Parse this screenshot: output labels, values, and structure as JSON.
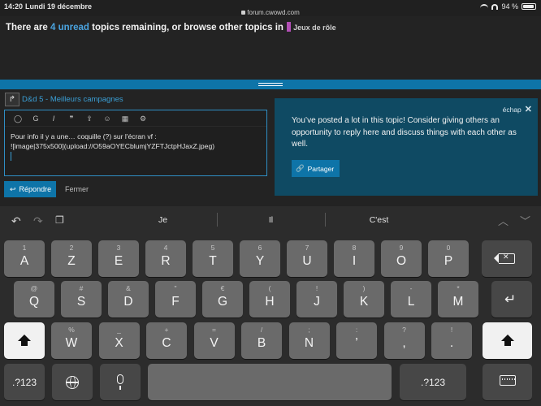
{
  "status": {
    "time": "14:20",
    "date": "Lundi 19 décembre",
    "url": "forum.cwowd.com",
    "battery": "94 %"
  },
  "topic_footer": {
    "prefix": "There are",
    "unread_link": "4 unread",
    "suffix": "topics remaining, or browse other topics in",
    "category": "Jeux de rôle",
    "category_color": "#b24fb5"
  },
  "composer": {
    "topic_title": "D&d 5 - Meilleurs campagnes",
    "toolbar_labels": {
      "heading": "G",
      "italic": "I",
      "quote": "❞"
    },
    "body_lines": [
      "Pour info il y a une… coquille (?) sur l'écran vf :",
      "![image|375x500](upload://O59aOYECblumjYZFTJctpHJaxZ.jpeg)"
    ],
    "reply_label": "Répondre",
    "close_label": "Fermer",
    "accent": "#0e74a8"
  },
  "suggestion": {
    "esc_label": "échap",
    "message": "You’ve posted a lot in this topic! Consider giving others an opportunity to reply here and discuss things with each other as well.",
    "share_label": "Partager"
  },
  "keyboard": {
    "predictions": [
      "Je",
      "Il",
      "C'est"
    ],
    "row1": [
      {
        "sec": "1",
        "pri": "A"
      },
      {
        "sec": "2",
        "pri": "Z"
      },
      {
        "sec": "3",
        "pri": "E"
      },
      {
        "sec": "4",
        "pri": "R"
      },
      {
        "sec": "5",
        "pri": "T"
      },
      {
        "sec": "6",
        "pri": "Y"
      },
      {
        "sec": "7",
        "pri": "U"
      },
      {
        "sec": "8",
        "pri": "I"
      },
      {
        "sec": "9",
        "pri": "O"
      },
      {
        "sec": "0",
        "pri": "P"
      }
    ],
    "row2": [
      {
        "sec": "@",
        "pri": "Q"
      },
      {
        "sec": "#",
        "pri": "S"
      },
      {
        "sec": "&",
        "pri": "D"
      },
      {
        "sec": "\"",
        "pri": "F"
      },
      {
        "sec": "€",
        "pri": "G"
      },
      {
        "sec": "(",
        "pri": "H"
      },
      {
        "sec": "!",
        "pri": "J"
      },
      {
        "sec": ")",
        "pri": "K"
      },
      {
        "sec": "-",
        "pri": "L"
      },
      {
        "sec": "*",
        "pri": "M"
      }
    ],
    "row3": [
      {
        "sec": "%",
        "pri": "W"
      },
      {
        "sec": "_",
        "pri": "X"
      },
      {
        "sec": "+",
        "pri": "C"
      },
      {
        "sec": "=",
        "pri": "V"
      },
      {
        "sec": "/",
        "pri": "B"
      },
      {
        "sec": ";",
        "pri": "N"
      },
      {
        "sec": ":",
        "pri": "’"
      },
      {
        "sec": "?",
        "pri": ","
      },
      {
        "sec": "!",
        "pri": "."
      }
    ],
    "numbers_label": ".?123"
  }
}
